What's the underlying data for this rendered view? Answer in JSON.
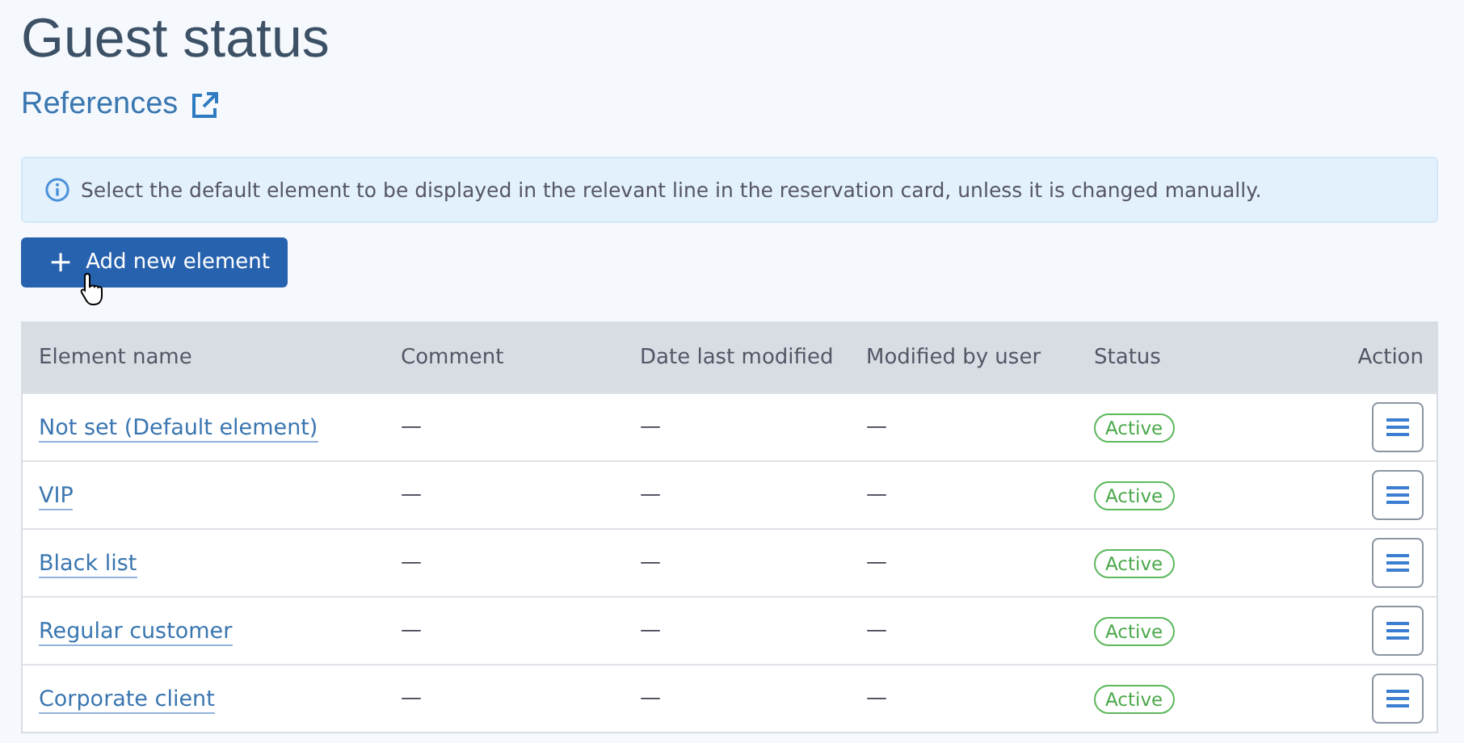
{
  "title": "Guest status",
  "references_link": "References",
  "info": "Select the default element to be displayed in the relevant line in the reservation card, unless it is changed manually.",
  "add_button": {
    "label": "Add new element",
    "plus": "+"
  },
  "table": {
    "columns": [
      "Element name",
      "Comment",
      "Date last modified",
      "Modified by user",
      "Status",
      "Action"
    ],
    "rows": [
      {
        "name": "Not set (Default element)",
        "comment": "—",
        "date": "—",
        "user": "—",
        "status": "Active"
      },
      {
        "name": "VIP",
        "comment": "—",
        "date": "—",
        "user": "—",
        "status": "Active"
      },
      {
        "name": "Black list",
        "comment": "—",
        "date": "—",
        "user": "—",
        "status": "Active"
      },
      {
        "name": "Regular customer",
        "comment": "—",
        "date": "—",
        "user": "—",
        "status": "Active"
      },
      {
        "name": "Corporate client",
        "comment": "—",
        "date": "—",
        "user": "—",
        "status": "Active"
      }
    ]
  }
}
